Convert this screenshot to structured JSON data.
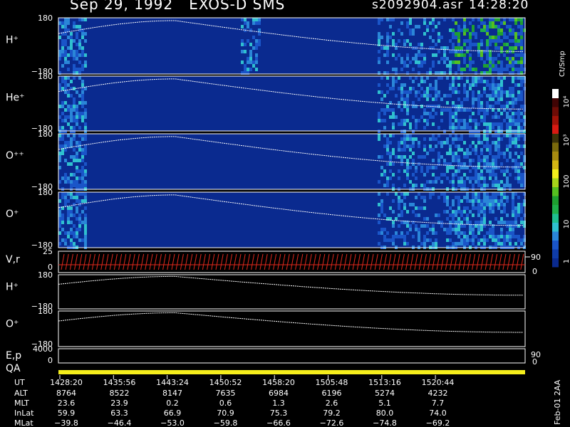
{
  "header": {
    "title": "Sep 29, 1992   EXOS-D SMS",
    "file": "s2092904.asr",
    "time": "14:28:20"
  },
  "colorbar": {
    "units": "Ct/Smp",
    "tick_labels": [
      "1",
      "10",
      "100",
      "10³",
      "10⁴"
    ],
    "colors": [
      "#0a2a8f",
      "#0f3ca8",
      "#1a55c8",
      "#2a86d8",
      "#2fc0cf",
      "#1fbf8f",
      "#1fb04a",
      "#1ea030",
      "#55c020",
      "#a6d61a",
      "#f2ee1c",
      "#d4b514",
      "#a68a10",
      "#7a6a0c",
      "#3a3208",
      "#d81a12",
      "#a01208",
      "#6e0c06",
      "#400404",
      "#ffffff"
    ]
  },
  "chart_data": {
    "type": "heatmap",
    "panels": [
      {
        "label": "H⁺",
        "ytick_top": "180",
        "ytick_bottom": "180",
        "kind": "spectrogram"
      },
      {
        "label": "He⁺",
        "ytick_top": "180",
        "ytick_bottom": "180",
        "kind": "spectrogram"
      },
      {
        "label": "O⁺⁺",
        "ytick_top": "180",
        "ytick_bottom": "180",
        "kind": "spectrogram"
      },
      {
        "label": "O⁺",
        "ytick_top": "180",
        "ytick_bottom": "180",
        "kind": "spectrogram"
      },
      {
        "label": "V,r",
        "ytick_top": "25",
        "ytick_bottom": "0",
        "right_tick_top": "90",
        "right_tick_bottom": "0",
        "kind": "vector"
      },
      {
        "label": "H⁺",
        "ytick_top": "180",
        "ytick_bottom": "180",
        "kind": "line"
      },
      {
        "label": "O⁺",
        "ytick_top": "180",
        "ytick_bottom": "180",
        "kind": "line"
      },
      {
        "label": "E,p",
        "ytick_top": "4000",
        "ytick_bottom": "0",
        "right_tick_top": "90",
        "right_tick_bottom": "0",
        "kind": "empty"
      },
      {
        "label": "QA",
        "kind": "qa"
      }
    ],
    "ephemeris": {
      "row_labels": [
        "UT",
        "ALT",
        "MLT",
        "InLat",
        "MLat"
      ],
      "columns": [
        [
          "1428:20",
          "8764",
          "23.6",
          "59.9",
          "−39.8"
        ],
        [
          "1435:56",
          "8522",
          "23.9",
          "63.3",
          "−46.4"
        ],
        [
          "1443:24",
          "8147",
          "0.2",
          "66.9",
          "−53.0"
        ],
        [
          "1450:52",
          "7635",
          "0.6",
          "70.9",
          "−59.8"
        ],
        [
          "1458:20",
          "6984",
          "1.3",
          "75.3",
          "−66.6"
        ],
        [
          "1505:48",
          "6196",
          "2.6",
          "79.2",
          "−72.6"
        ],
        [
          "1513:16",
          "5274",
          "5.1",
          "80.0",
          "−74.8"
        ],
        [
          "1520:44",
          "4232",
          "7.7",
          "74.0",
          "−69.2"
        ]
      ]
    },
    "footer": "Feb-01 2AA"
  }
}
